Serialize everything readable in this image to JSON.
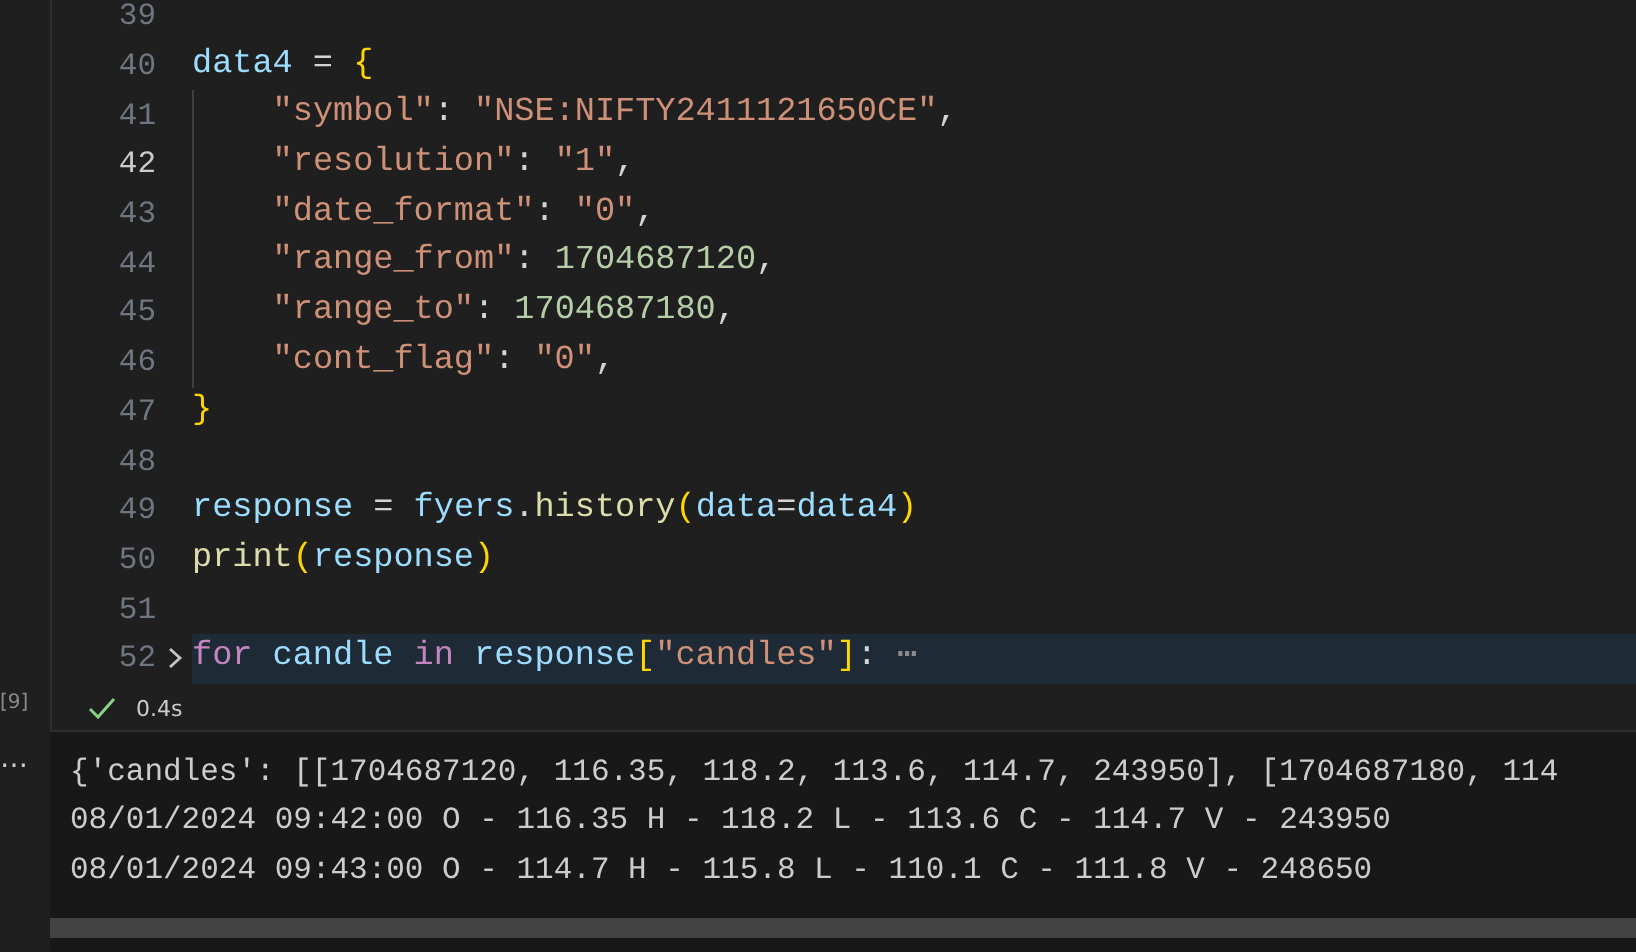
{
  "editor": {
    "lines": [
      {
        "number": "39",
        "current": false,
        "folded": false,
        "indented": false
      },
      {
        "number": "40",
        "current": false,
        "folded": false,
        "indented": false,
        "tokens": [
          {
            "text": "data4",
            "kind": "var"
          },
          {
            "text": " = ",
            "kind": "punct"
          },
          {
            "text": "{",
            "kind": "bracket"
          }
        ]
      },
      {
        "number": "41",
        "current": false,
        "folded": false,
        "indented": true,
        "tokens": [
          {
            "text": "\"symbol\"",
            "kind": "string"
          },
          {
            "text": ": ",
            "kind": "punct"
          },
          {
            "text": "\"NSE:NIFTY2411121650CE\"",
            "kind": "string"
          },
          {
            "text": ",",
            "kind": "punct"
          }
        ]
      },
      {
        "number": "42",
        "current": true,
        "folded": false,
        "indented": true,
        "tokens": [
          {
            "text": "\"resolution\"",
            "kind": "string"
          },
          {
            "text": ": ",
            "kind": "punct"
          },
          {
            "text": "\"1\"",
            "kind": "string"
          },
          {
            "text": ",",
            "kind": "punct"
          }
        ]
      },
      {
        "number": "43",
        "current": false,
        "folded": false,
        "indented": true,
        "tokens": [
          {
            "text": "\"date_format\"",
            "kind": "string"
          },
          {
            "text": ": ",
            "kind": "punct"
          },
          {
            "text": "\"0\"",
            "kind": "string"
          },
          {
            "text": ",",
            "kind": "punct"
          }
        ]
      },
      {
        "number": "44",
        "current": false,
        "folded": false,
        "indented": true,
        "tokens": [
          {
            "text": "\"range_from\"",
            "kind": "string"
          },
          {
            "text": ": ",
            "kind": "punct"
          },
          {
            "text": "1704687120",
            "kind": "number"
          },
          {
            "text": ",",
            "kind": "punct"
          }
        ]
      },
      {
        "number": "45",
        "current": false,
        "folded": false,
        "indented": true,
        "tokens": [
          {
            "text": "\"range_to\"",
            "kind": "string"
          },
          {
            "text": ": ",
            "kind": "punct"
          },
          {
            "text": "1704687180",
            "kind": "number"
          },
          {
            "text": ",",
            "kind": "punct"
          }
        ]
      },
      {
        "number": "46",
        "current": false,
        "folded": false,
        "indented": true,
        "tokens": [
          {
            "text": "\"cont_flag\"",
            "kind": "string"
          },
          {
            "text": ": ",
            "kind": "punct"
          },
          {
            "text": "\"0\"",
            "kind": "string"
          },
          {
            "text": ",",
            "kind": "punct"
          }
        ]
      },
      {
        "number": "47",
        "current": false,
        "folded": false,
        "indented": false,
        "tokens": [
          {
            "text": "}",
            "kind": "bracket"
          }
        ]
      },
      {
        "number": "48",
        "current": false,
        "folded": false,
        "indented": false
      },
      {
        "number": "49",
        "current": false,
        "folded": false,
        "indented": false,
        "tokens": [
          {
            "text": "response",
            "kind": "var"
          },
          {
            "text": " = ",
            "kind": "punct"
          },
          {
            "text": "fyers",
            "kind": "var"
          },
          {
            "text": ".",
            "kind": "punct"
          },
          {
            "text": "history",
            "kind": "func"
          },
          {
            "text": "(",
            "kind": "bracket"
          },
          {
            "text": "data",
            "kind": "var"
          },
          {
            "text": "=",
            "kind": "punct"
          },
          {
            "text": "data4",
            "kind": "var"
          },
          {
            "text": ")",
            "kind": "bracket"
          }
        ]
      },
      {
        "number": "50",
        "current": false,
        "folded": false,
        "indented": false,
        "tokens": [
          {
            "text": "print",
            "kind": "func"
          },
          {
            "text": "(",
            "kind": "bracket"
          },
          {
            "text": "response",
            "kind": "var"
          },
          {
            "text": ")",
            "kind": "bracket"
          }
        ]
      },
      {
        "number": "51",
        "current": false,
        "folded": false,
        "indented": false
      },
      {
        "number": "52",
        "current": false,
        "folded": true,
        "indented": false,
        "tokens": [
          {
            "text": "for",
            "kind": "keyword"
          },
          {
            "text": " candle",
            "kind": "var"
          },
          {
            "text": " in",
            "kind": "keyword"
          },
          {
            "text": " response",
            "kind": "var"
          },
          {
            "text": "[",
            "kind": "bracket"
          },
          {
            "text": "\"candles\"",
            "kind": "string"
          },
          {
            "text": "]",
            "kind": "bracket"
          },
          {
            "text": ":",
            "kind": "punct"
          },
          {
            "text": " ⋯",
            "kind": "ellipsis"
          }
        ]
      }
    ]
  },
  "cell_status": {
    "execution_count": "[9]",
    "succeeded": true,
    "time": "0.4s"
  },
  "output": {
    "menu": "⋯",
    "lines": [
      "{'candles': [[1704687120, 116.35, 118.2, 113.6, 114.7, 243950], [1704687180, 114",
      "08/01/2024 09:42:00 O - 116.35 H - 118.2 L - 113.6 C - 114.7 V - 243950",
      "08/01/2024 09:43:00 O - 114.7 H - 115.8 L - 110.1 C - 111.8 V - 248650"
    ]
  }
}
